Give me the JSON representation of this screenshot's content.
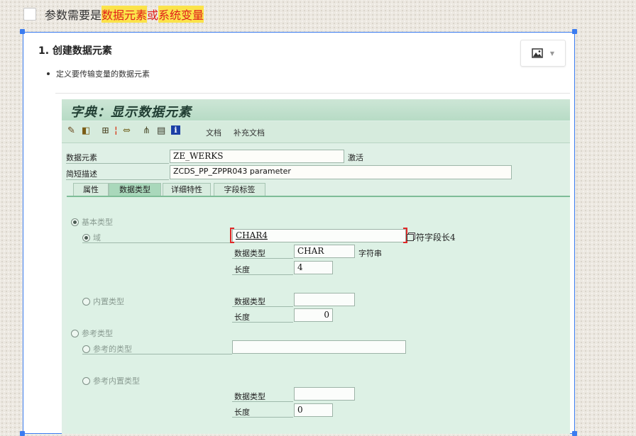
{
  "todo": {
    "segments": [
      {
        "text": "参数需要是",
        "style": "normal"
      },
      {
        "text": "数据元素",
        "style": "hl-red"
      },
      {
        "text": "或",
        "style": "red"
      },
      {
        "text": "系统变量",
        "style": "hl-red"
      }
    ]
  },
  "doc": {
    "heading": "1. 创建数据元素",
    "bullet": "定义要传输变量的数据元素",
    "image_button_icon": "image-icon"
  },
  "sap": {
    "title": "字典：显示数据元素",
    "toolbar": {
      "icons": [
        "pencil-glasses-icon",
        "display-change-icon",
        "hierarchy-icon",
        "info-marker-icon",
        "where-used-icon",
        "object-list-icon",
        "print-icon",
        "info-icon"
      ],
      "doc_label": "文档",
      "supp_doc_label": "补充文档"
    },
    "data_element_label": "数据元素",
    "data_element_value": "ZE_WERKS",
    "status": "激活",
    "short_desc_label": "简短描述",
    "short_desc_value": "ZCDS_PP_ZPPR043 parameter",
    "tabs": [
      "属性",
      "数据类型",
      "详细特性",
      "字段标签"
    ],
    "active_tab": "数据类型",
    "elementary_type_label": "基本类型",
    "domain_label": "域",
    "domain_value": "CHAR4",
    "domain_desc": "符字段长4",
    "data_type_label": "数据类型",
    "data_type_value": "CHAR",
    "data_type_desc": "字符串",
    "length_label": "长度",
    "length_value": "4",
    "builtin_type_label": "内置类型",
    "builtin_data_type_label": "数据类型",
    "builtin_length_label": "长度",
    "builtin_length_value": "0",
    "reference_type_label": "参考类型",
    "ref_type_label": "参考的类型",
    "ref_builtin_label": "参考内置类型",
    "ref_data_type_label": "数据类型",
    "ref_length_label": "长度",
    "ref_length_value": "0"
  }
}
